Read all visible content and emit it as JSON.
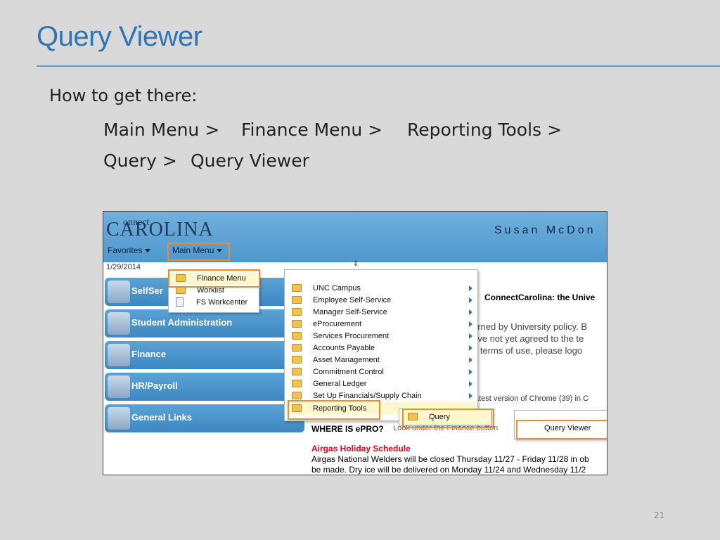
{
  "slide": {
    "title": "Query Viewer",
    "how_to": "How to get there:",
    "path_line1": [
      "Main Menu >",
      "Finance Menu >",
      "Reporting Tools >"
    ],
    "path_line2": [
      "Query >",
      "Query Viewer"
    ],
    "page_number": "21"
  },
  "screenshot": {
    "logo_connect": "onnect",
    "logo_carolina": "CAROLINA",
    "user": "Susan McDon",
    "nav": {
      "favorites": "Favorites",
      "main_menu": "Main Menu"
    },
    "date": "1/29/2014",
    "tiles": [
      "SelfSer",
      "Student Administration",
      "Finance",
      "HR/Payroll",
      "General Links"
    ],
    "main_menu_items": [
      {
        "label": "Finance Menu",
        "icon": "folder-icon"
      },
      {
        "label": "Worklist",
        "icon": "folder-icon"
      },
      {
        "label": "FS Workcenter",
        "icon": "document-icon"
      }
    ],
    "finance_menu_items": [
      "UNC Campus",
      "Employee Self-Service",
      "Manager Self-Service",
      "eProcurement",
      "Services Procurement",
      "Accounts Payable",
      "Asset Management",
      "Commitment Control",
      "General Ledger",
      "Set Up Financials/Supply Chain",
      "Reporting Tools"
    ],
    "reporting_tools_items": [
      "Query"
    ],
    "query_items": [
      "Query Viewer"
    ],
    "content": {
      "cc_title": "ConnectCarolina: the Unive",
      "policy_lines": [
        "erned by University policy. B",
        "ave not yet agreed to the te",
        "e terms of use, please logo"
      ],
      "chrome_line": "atest version of Chrome (39) in C",
      "where_title": "WHERE IS ePRO?",
      "where_rest": "Look under the Finance button",
      "airgas_heading": "Airgas Holiday Schedule",
      "airgas_line1": "Airgas National Welders will be closed Thursday 11/27 - Friday 11/28 in ob",
      "airgas_line2": "be made.  Dry ice will be delivered on Monday 11/24 and Wednesday 11/2"
    }
  },
  "colors": {
    "title": "#2e75b6",
    "highlight": "#f08a2a",
    "banner": "#4e97cd"
  }
}
